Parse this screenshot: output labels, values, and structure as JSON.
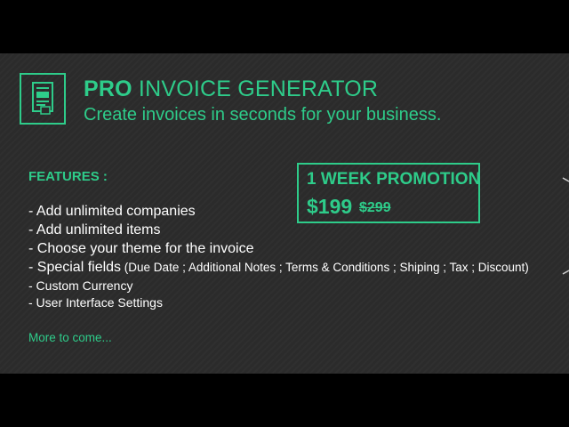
{
  "header": {
    "title_bold": "PRO",
    "title_rest": " INVOICE GENERATOR",
    "subtitle": "Create invoices in seconds for your business.",
    "logo_icon": "invoice-document-icon"
  },
  "features": {
    "heading": "FEATURES :",
    "items": [
      "- Add unlimited companies",
      "- Add unlimited items",
      "- Choose your theme for the invoice",
      "- Special fields",
      "- Custom Currency",
      "- User Interface Settings"
    ],
    "special_fields_detail": " (Due Date ; Additional Notes ; Terms & Conditions ; Shiping ; Tax ; Discount)",
    "more": "More to come..."
  },
  "promo": {
    "title": "1 WEEK PROMOTION",
    "price": "$199",
    "old_price": "$299"
  },
  "colors": {
    "accent": "#2ecc8a",
    "panel_bg": "#2b2b2b",
    "text": "#ffffff"
  }
}
